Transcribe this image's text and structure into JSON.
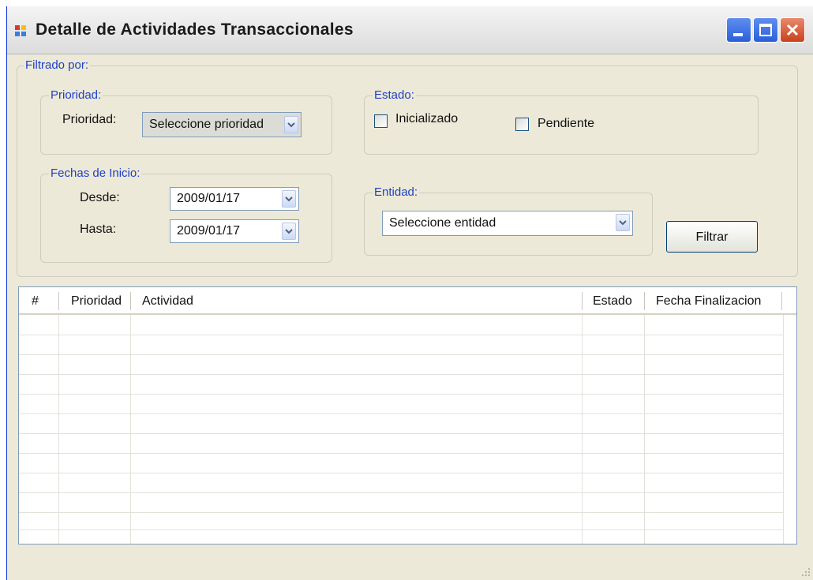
{
  "window": {
    "title": "Detalle de Actividades Transaccionales",
    "controls": {
      "minimize": "minimize",
      "maximize": "maximize",
      "close": "close"
    }
  },
  "filter": {
    "legend": "Filtrado por:",
    "prioridad": {
      "legend": "Prioridad:",
      "label": "Prioridad:",
      "selected": "Seleccione prioridad"
    },
    "estado": {
      "legend": "Estado:",
      "options": [
        {
          "label": "Inicializado",
          "checked": false
        },
        {
          "label": "Pendiente",
          "checked": false
        }
      ]
    },
    "fechas": {
      "legend": "Fechas de Inicio:",
      "desde_label": "Desde:",
      "desde_value": "2009/01/17",
      "hasta_label": "Hasta:",
      "hasta_value": "2009/01/17"
    },
    "entidad": {
      "legend": "Entidad:",
      "selected": "Seleccione entidad"
    },
    "filter_button": "Filtrar"
  },
  "grid": {
    "columns": [
      "#",
      "Prioridad",
      "Actividad",
      "Estado",
      "Fecha Finalizacion"
    ],
    "rows": []
  },
  "colors": {
    "legend_text": "#1e3fc8",
    "window_bg": "#ece9d8",
    "titlebar_start": "#f4f4f4",
    "close_button": "#c9421e"
  }
}
